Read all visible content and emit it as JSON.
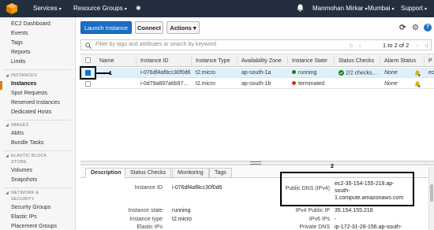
{
  "nav": {
    "services": "Services",
    "resource_groups": "Resource Groups",
    "pin": "✱",
    "bell": "🔔",
    "user": "Manmohan Mirkar",
    "region": "Mumbai",
    "support": "Support",
    "caret": "▾"
  },
  "sidebar": {
    "top_items": [
      {
        "label": "EC2 Dashboard"
      },
      {
        "label": "Events"
      },
      {
        "label": "Tags"
      },
      {
        "label": "Reports"
      },
      {
        "label": "Limits"
      }
    ],
    "sections": [
      {
        "title": "INSTANCES",
        "items": [
          "Instances",
          "Spot Requests",
          "Reserved Instances",
          "Dedicated Hosts"
        ]
      },
      {
        "title": "IMAGES",
        "items": [
          "AMIs",
          "Bundle Tasks"
        ]
      },
      {
        "title_line1": "ELASTIC BLOCK",
        "title_line2": "STORE",
        "items": [
          "Volumes",
          "Snapshots"
        ]
      },
      {
        "title_line1": "NETWORK &",
        "title_line2": "SECURITY",
        "items": [
          "Security Groups",
          "Elastic IPs",
          "Placement Groups"
        ]
      }
    ],
    "triangle": "◢"
  },
  "toolbar": {
    "launch_label": "Launch Instance",
    "connect_label": "Connect",
    "actions_label": "Actions ▾",
    "refresh_icon": "⟳",
    "settings_icon": "⚙",
    "help_icon": "?"
  },
  "filter": {
    "placeholder": "Filter by tags and attributes or search by keyword",
    "search_icon": "🔍",
    "pager_first": "|‹",
    "pager_prev": "‹",
    "pager_text": "1 to 2 of 2",
    "pager_next": "›",
    "pager_last": "›|"
  },
  "table": {
    "headers": [
      "Name",
      "Instance ID",
      "Instance Type",
      "Availability Zone",
      "Instance State",
      "Status Checks",
      "Alarm Status",
      "P"
    ],
    "sort_icon": "▾",
    "rows": [
      {
        "name": "",
        "id": "i-076df4af8cc30f0d6",
        "type": "t2.micro",
        "zone": "ap-south-1a",
        "state": "running",
        "state_color": "#1d8102",
        "checks": "2/2 checks...",
        "alarm": "None",
        "extra": "ec"
      },
      {
        "name": "",
        "id": "i-0d79a897a6b97...",
        "type": "t2.micro",
        "zone": "ap-south-1b",
        "state": "terminated",
        "state_color": "#d13212",
        "checks": "",
        "alarm": "None",
        "extra": ""
      }
    ],
    "bell_icon": "🔔"
  },
  "annotations": {
    "label1": "1",
    "label2": "2"
  },
  "details": {
    "tabs": [
      "Description",
      "Status Checks",
      "Monitoring",
      "Tags"
    ],
    "left": [
      {
        "label": "Instance ID",
        "value": "i-076df4af8cc30f0d6"
      },
      {
        "label": "Instance state",
        "value": "running"
      },
      {
        "label": "Instance type",
        "value": "t2.micro"
      },
      {
        "label": "Elastic IPs",
        "value": ""
      }
    ],
    "right": [
      {
        "label": "Public DNS (IPv4)",
        "value_line1": "ec2-35-154-155-218.ap-",
        "value_line2": "south-",
        "value_line3": "1.compute.amazonaws.com"
      },
      {
        "label": "IPv4 Public IP",
        "value": "35.154.155.218"
      },
      {
        "label": "IPv6 IPs",
        "value": "-"
      },
      {
        "label": "Private DNS",
        "value": "ip-172-31-28-156.ap-south-"
      }
    ]
  }
}
